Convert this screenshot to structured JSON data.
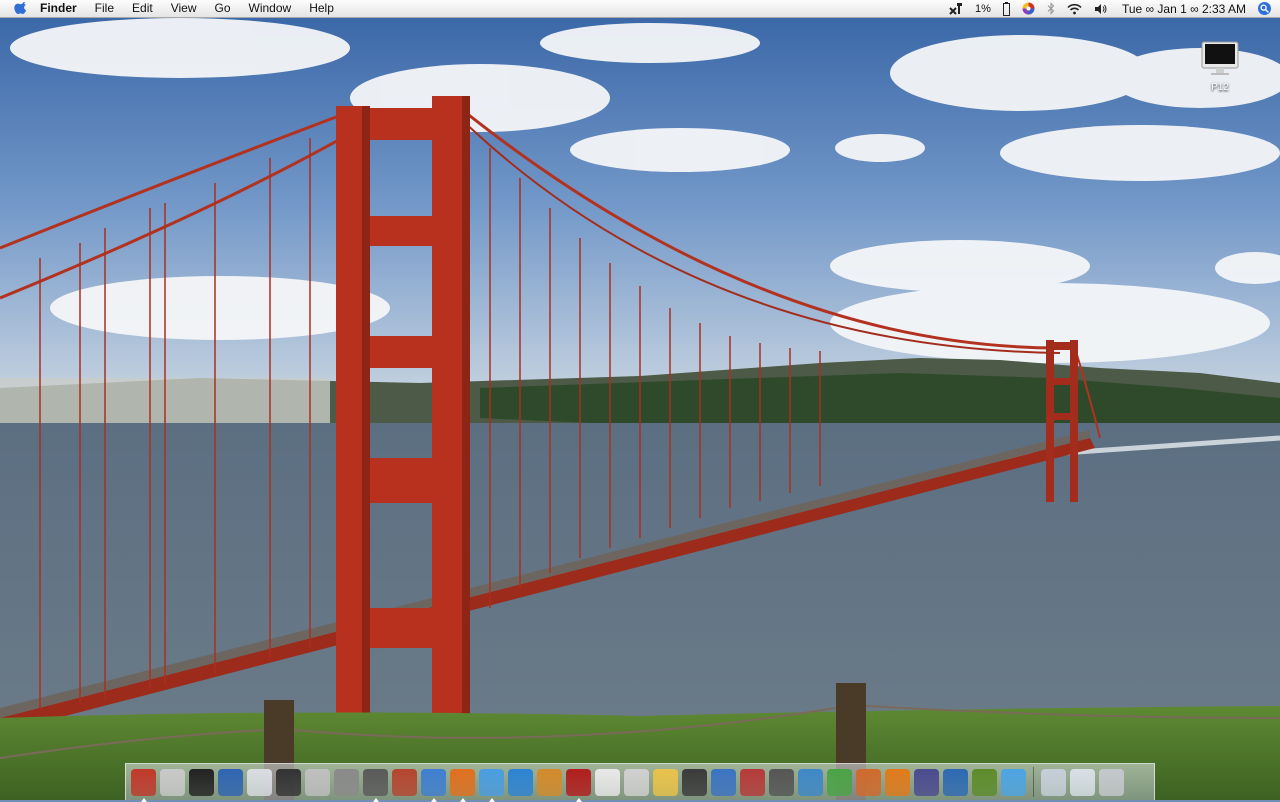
{
  "menubar": {
    "app_name": "Finder",
    "menus": [
      "File",
      "Edit",
      "View",
      "Go",
      "Window",
      "Help"
    ],
    "battery_percent": "1%",
    "clock": "Tue ∞ Jan 1 ∞ 2:33 AM"
  },
  "desktop": {
    "hd_label": "P12"
  },
  "dock": {
    "items": [
      {
        "icon": "finder-icon",
        "color": "#c0392b",
        "running": true
      },
      {
        "icon": "apple-icon",
        "color": "#c9c9c9",
        "running": false
      },
      {
        "icon": "terminal-icon",
        "color": "#222222",
        "running": false
      },
      {
        "icon": "safari-compass-icon",
        "color": "#2f64b2",
        "running": false
      },
      {
        "icon": "airport-wifi-icon",
        "color": "#d9dde2",
        "running": false
      },
      {
        "icon": "activity-monitor-icon",
        "color": "#333333",
        "running": false
      },
      {
        "icon": "disk-utility-icon",
        "color": "#bfbfbf",
        "running": false
      },
      {
        "icon": "network-icon",
        "color": "#8a8a8a",
        "running": false
      },
      {
        "icon": "clock-icon",
        "color": "#5a5a5a",
        "running": true
      },
      {
        "icon": "photo-icon",
        "color": "#b5452f",
        "running": false
      },
      {
        "icon": "safari-icon",
        "color": "#3f7fd1",
        "running": true
      },
      {
        "icon": "firefox-icon",
        "color": "#e0701f",
        "running": true
      },
      {
        "icon": "itunes-icon",
        "color": "#4a9de0",
        "running": true
      },
      {
        "icon": "quicktime-icon",
        "color": "#2d83d3",
        "running": false
      },
      {
        "icon": "iphoto-icon",
        "color": "#d38a2b",
        "running": false
      },
      {
        "icon": "photo-booth-icon",
        "color": "#b11d1d",
        "running": true
      },
      {
        "icon": "flickr-uploadr-icon",
        "color": "#e8e8e8",
        "running": false
      },
      {
        "icon": "mail-stamp-icon",
        "color": "#d0d0d0",
        "running": false
      },
      {
        "icon": "drive-icon",
        "color": "#e8c24a",
        "running": false
      },
      {
        "icon": "document-icon",
        "color": "#3a3a3a",
        "running": false
      },
      {
        "icon": "folder-blue-icon",
        "color": "#3b73c2",
        "running": false
      },
      {
        "icon": "sync-icon",
        "color": "#b63a3a",
        "running": false
      },
      {
        "icon": "magnifier-icon",
        "color": "#555555",
        "running": false
      },
      {
        "icon": "chart-icon",
        "color": "#3e88c7",
        "running": false
      },
      {
        "icon": "nvu-icon",
        "color": "#4ba346",
        "running": false
      },
      {
        "icon": "server-icon",
        "color": "#d06a2c",
        "running": false
      },
      {
        "icon": "p-app-icon",
        "color": "#e07a1a",
        "running": false
      },
      {
        "icon": "feather-icon",
        "color": "#4b4b8f",
        "running": false
      },
      {
        "icon": "word-icon",
        "color": "#2e6ab3",
        "running": false
      },
      {
        "icon": "gardener-icon",
        "color": "#5d8c2b",
        "running": false
      },
      {
        "icon": "fish-icon",
        "color": "#4da4e3",
        "running": false
      },
      {
        "icon": "shield-icon",
        "color": "#c6cfd8",
        "running": false
      },
      {
        "icon": "applications-folder-icon",
        "color": "#d8dfe6",
        "running": false
      },
      {
        "icon": "trash-icon",
        "color": "#c4c8cc",
        "running": false
      }
    ]
  }
}
